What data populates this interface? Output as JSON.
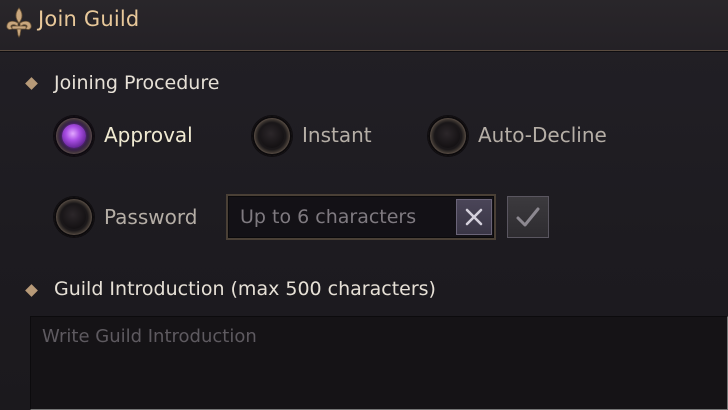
{
  "header": {
    "title": "Join Guild",
    "icon": "fleur-de-lis-icon",
    "accent_color": "#e8c89a"
  },
  "joining_procedure": {
    "title": "Joining Procedure",
    "options": [
      {
        "label": "Approval",
        "selected": true
      },
      {
        "label": "Instant",
        "selected": false
      },
      {
        "label": "Auto-Decline",
        "selected": false
      },
      {
        "label": "Password",
        "selected": false
      }
    ],
    "selected_color": "#a94ee4",
    "password": {
      "value": "",
      "placeholder": "Up to 6 characters",
      "clear_icon": "close-icon",
      "confirm_icon": "checkmark-icon"
    }
  },
  "introduction": {
    "title": "Guild Introduction (max 500 characters)",
    "value": "",
    "placeholder": "Write Guild Introduction"
  }
}
